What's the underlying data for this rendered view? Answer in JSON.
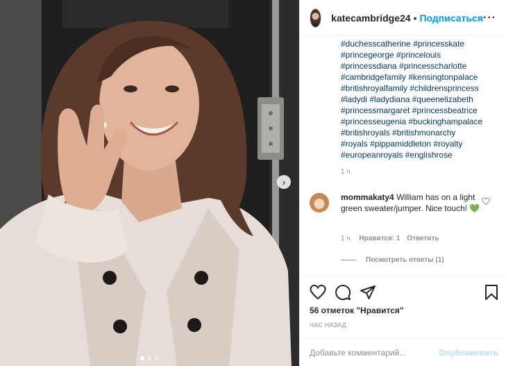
{
  "post": {
    "username": "katecambridge24",
    "separator": "•",
    "follow_label": "Подписаться",
    "more_label": "···",
    "caption_tags": [
      "#duchesscatherine #princesskate",
      "#princegeorge #princelouis",
      "#princessdiana #princesscharlotte",
      "#cambridgefamily #kensingtonpalace",
      "#britishroyalfamily #childrensprincess",
      "#ladydi #ladydiana #queenelizabeth",
      "#princessmargaret #princessbeatrice",
      "#princesseugenia #buckinghampalace",
      "#britishroyals #britishmonarchy",
      "#royals #pippamiddleton #royalty",
      "#europeanroyals #englishrose"
    ],
    "caption_time": "1 ч."
  },
  "comment": {
    "username": "mommakaty4",
    "text": "William has on a light green sweater/jumper. Nice touch! 💚",
    "time": "1 ч.",
    "likes_label": "Нравится: 1",
    "reply_label": "Ответить",
    "view_replies_label": "Посмотреть ответы (1)"
  },
  "stats": {
    "likes_text": "56 отметок \"Нравится\"",
    "posted_text": "ЧАС НАЗАД"
  },
  "composer": {
    "placeholder": "Добавьте комментарий...",
    "publish_label": "Опубликовать"
  },
  "carousel": {
    "slide_count": 3,
    "active_index": 0,
    "next_arrow": "›"
  },
  "icons": {
    "like": "heart-icon",
    "comment": "comment-icon",
    "share": "send-icon",
    "save": "bookmark-icon",
    "comment_like": "heart-icon"
  },
  "colors": {
    "accent": "#0095f6",
    "hashtag": "#00376b",
    "muted": "#8e8e8e",
    "publish_disabled": "#b2dffc"
  }
}
